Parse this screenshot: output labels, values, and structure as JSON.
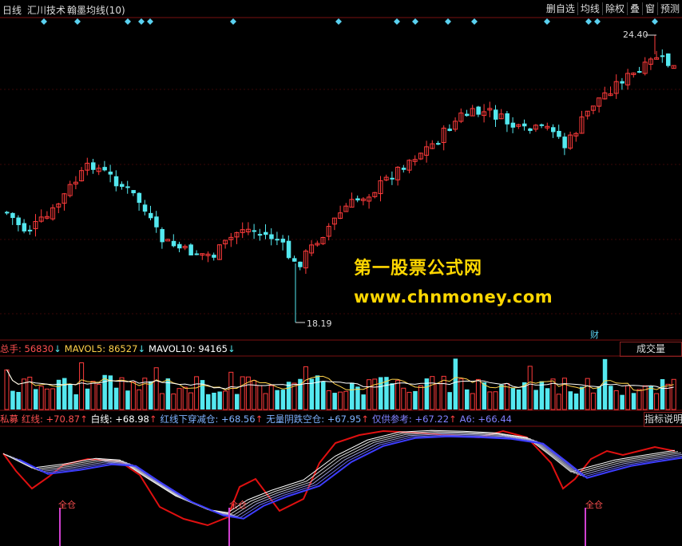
{
  "header": {
    "period": "日线",
    "source": "汇川技术",
    "indicator": "翰墨均线(10)"
  },
  "toolbar": [
    {
      "label": "删自选",
      "name": "remove-watchlist-button"
    },
    {
      "label": "均线",
      "name": "moving-average-button"
    },
    {
      "label": "除权",
      "name": "ex-rights-button"
    },
    {
      "label": "叠",
      "name": "overlay-button"
    },
    {
      "label": "窗",
      "name": "window-button"
    },
    {
      "label": "预测",
      "name": "forecast-button"
    }
  ],
  "price_panel": {
    "high_label": "24.40",
    "low_label": "18.19",
    "finance_mark": "财"
  },
  "volume_panel": {
    "items": [
      {
        "label": "总手:",
        "value": "56830",
        "arrow": "↓",
        "color": "#ff5050"
      },
      {
        "label": "MAVOL5:",
        "value": "86527",
        "arrow": "↓",
        "color": "#ffd24a"
      },
      {
        "label": "MAVOL10:",
        "value": "94165",
        "arrow": "↓",
        "color": "#ffffff"
      }
    ],
    "button": "成交量"
  },
  "indicator_panel": {
    "items": [
      {
        "label": "私募",
        "value": "",
        "arrow": "",
        "color": "#ff5050"
      },
      {
        "label": "红线:",
        "value": "+70.87",
        "arrow": "↑",
        "color": "#ff5050"
      },
      {
        "label": "白线:",
        "value": "+68.98",
        "arrow": "↑",
        "color": "#ffffff"
      },
      {
        "label": "红线下穿减仓:",
        "value": "+68.56",
        "arrow": "↑",
        "color": "#7fb2ff"
      },
      {
        "label": "无量阴跌空仓:",
        "value": "+67.95",
        "arrow": "↑",
        "color": "#7fb2ff"
      },
      {
        "label": "仅供参考:",
        "value": "+67.22",
        "arrow": "↑",
        "color": "#8080ff"
      },
      {
        "label": "A6:",
        "value": "+66.44",
        "arrow": "",
        "color": "#8080ff"
      }
    ],
    "button": "指标说明",
    "signals": [
      "全仓",
      "全仓",
      "全仓"
    ]
  },
  "watermark": {
    "line1": "第一股票公式网",
    "line2": "www.chnmoney.com"
  },
  "colors": {
    "up": "#ff3b3b",
    "down": "#54e8ef",
    "grid": "#7a1010",
    "diamond": "#5ad1f0",
    "watermark": "#ffd700"
  }
}
